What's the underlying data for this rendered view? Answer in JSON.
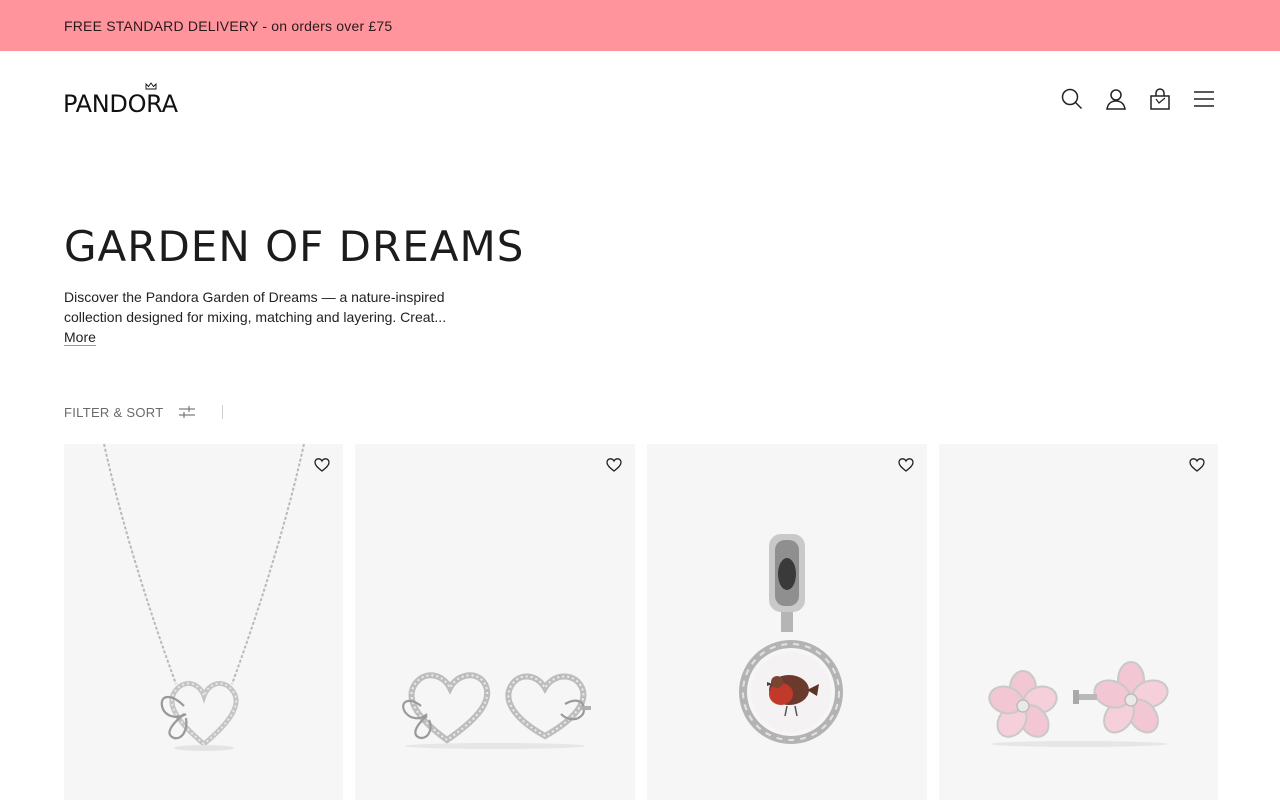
{
  "promo": {
    "text": "FREE STANDARD DELIVERY - on orders over £75"
  },
  "header": {
    "logo": "PANDORA",
    "icons": [
      "search-icon",
      "account-icon",
      "bag-icon",
      "menu-icon"
    ]
  },
  "hero": {
    "title": "GARDEN OF DREAMS",
    "description": "Discover the Pandora Garden of Dreams — a nature-inspired collection designed for mixing, matching and layering. Creat...",
    "more": "More"
  },
  "filter": {
    "label": "FILTER & SORT"
  },
  "products": [
    {
      "image": "heart-butterfly-necklace"
    },
    {
      "image": "heart-butterfly-stud-earrings"
    },
    {
      "image": "robin-dangle-charm"
    },
    {
      "image": "pink-flower-stud-earrings"
    }
  ],
  "colors": {
    "promo_bg": "#ff949d",
    "card_bg": "#f6f6f6",
    "text": "#1a1a1a"
  }
}
